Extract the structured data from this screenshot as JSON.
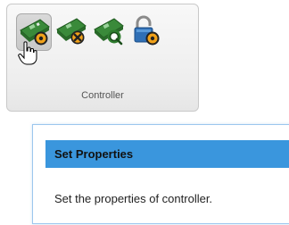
{
  "ribbon": {
    "group_label": "Controller",
    "buttons": [
      {
        "name": "set-properties",
        "icon": "controller-gear-icon",
        "state": "hover"
      },
      {
        "name": "tools",
        "icon": "controller-tools-icon"
      },
      {
        "name": "search",
        "icon": "controller-search-icon"
      },
      {
        "name": "lock-settings",
        "icon": "lock-gear-icon"
      }
    ]
  },
  "tooltip": {
    "title": "Set Properties",
    "description": "Set the properties of controller."
  },
  "colors": {
    "tooltip_header": "#3a96dd",
    "card_green": "#3a8a3a",
    "lock_blue": "#2f6fb5",
    "badge_orange": "#f1a21a"
  }
}
